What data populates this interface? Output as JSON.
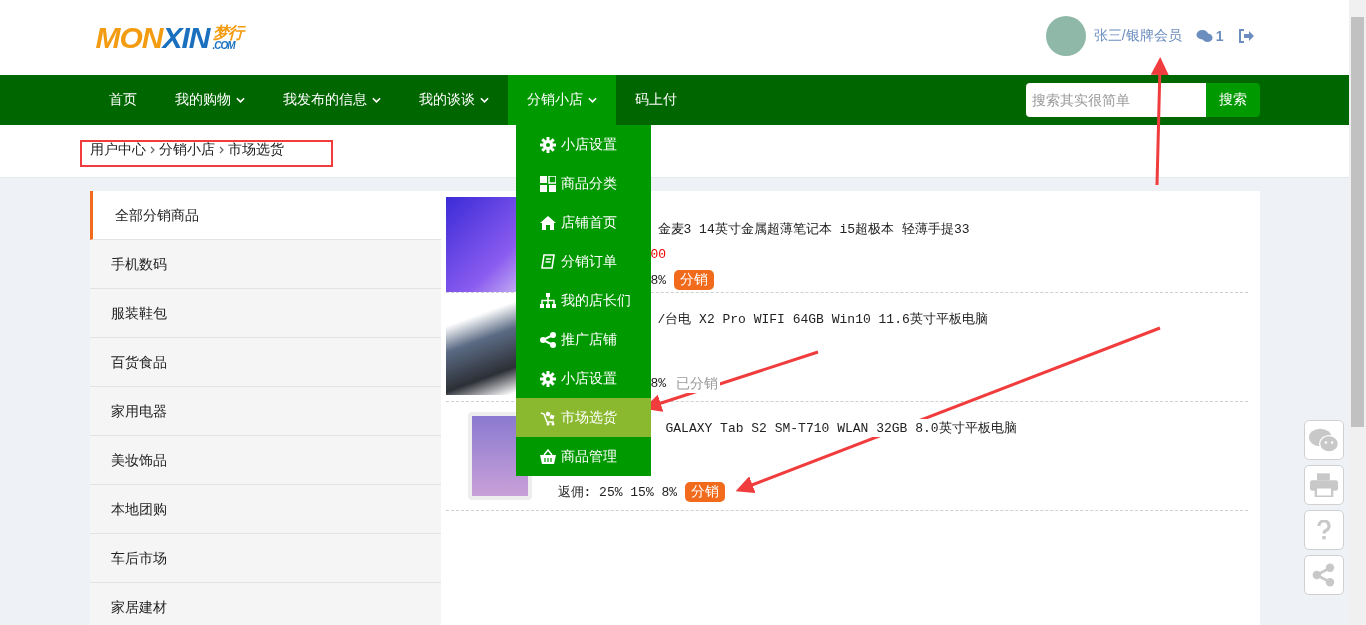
{
  "header": {
    "logo": {
      "part_a": "MON",
      "part_b": "XIN",
      "cn": "梦行",
      "domain": ".COM"
    },
    "user": {
      "name": "张三/银牌会员",
      "messages": "1"
    }
  },
  "nav": {
    "items": [
      {
        "label": "首页",
        "dropdown": false,
        "selected": false
      },
      {
        "label": "我的购物",
        "dropdown": true,
        "selected": false
      },
      {
        "label": "我发布的信息",
        "dropdown": true,
        "selected": false
      },
      {
        "label": "我的谈谈",
        "dropdown": true,
        "selected": false
      },
      {
        "label": "分销小店",
        "dropdown": true,
        "selected": true
      },
      {
        "label": "码上付",
        "dropdown": false,
        "selected": false
      }
    ],
    "search": {
      "placeholder": "搜索其实很简单",
      "button": "搜索"
    }
  },
  "dropdown_menu": {
    "items": [
      {
        "label": "小店设置",
        "selected": false
      },
      {
        "label": "商品分类",
        "selected": false
      },
      {
        "label": "店铺首页",
        "selected": false
      },
      {
        "label": "分销订单",
        "selected": false
      },
      {
        "label": "我的店长们",
        "selected": false
      },
      {
        "label": "推广店铺",
        "selected": false
      },
      {
        "label": "小店设置",
        "selected": false
      },
      {
        "label": "市场选货",
        "selected": true
      },
      {
        "label": "商品管理",
        "selected": false
      }
    ]
  },
  "breadcrumb": [
    "用户中心",
    "分销小店",
    "市场选货"
  ],
  "categories": [
    {
      "label": "全部分销商品",
      "selected": true
    },
    {
      "label": "手机数码",
      "selected": false
    },
    {
      "label": "服装鞋包",
      "selected": false
    },
    {
      "label": "百货食品",
      "selected": false
    },
    {
      "label": "家用电器",
      "selected": false
    },
    {
      "label": "美妆饰品",
      "selected": false
    },
    {
      "label": "本地团购",
      "selected": false
    },
    {
      "label": "车后市场",
      "selected": false
    },
    {
      "label": "家居建材",
      "selected": false
    }
  ],
  "products": [
    {
      "title": "金麦3 14英寸金属超薄笔记本 i5超极本 轻薄手提33",
      "price": "00",
      "commission": "8%",
      "action": {
        "label": "分销",
        "kind": "button"
      }
    },
    {
      "title": "/台电 X2 Pro WIFI 64GB Win10 11.6英寸平板电脑",
      "commission": "8%",
      "action": {
        "label": "已分销",
        "kind": "done"
      }
    },
    {
      "title": "GALAXY Tab S2 SM-T710 WLAN 32GB 8.0英寸平板电脑",
      "commission": "返佣: 25% 15% 8%",
      "action": {
        "label": "分销",
        "kind": "button"
      }
    }
  ]
}
